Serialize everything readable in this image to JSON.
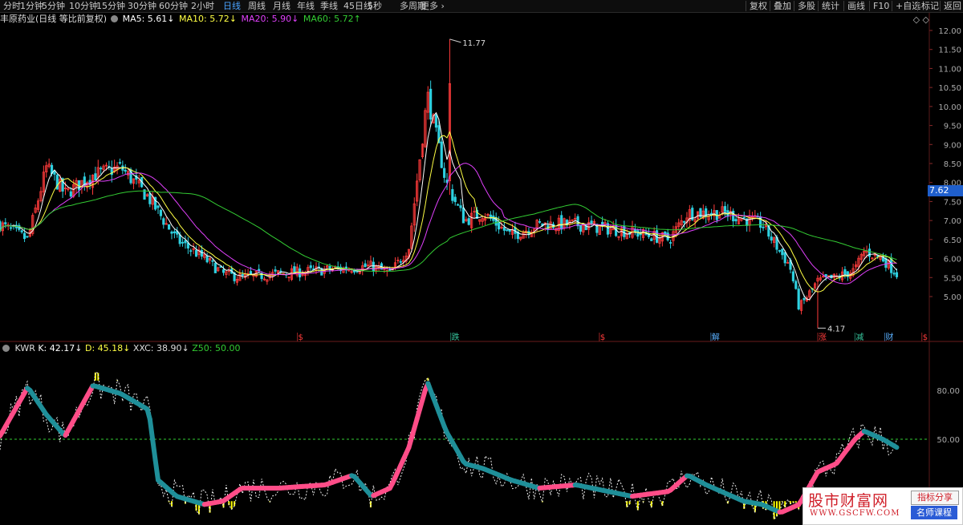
{
  "toolbar": {
    "left_items": [
      "分时",
      "1分钟",
      "5分钟",
      "10分钟",
      "15分钟",
      "30分钟",
      "60分钟",
      "2小时",
      "日线",
      "周线",
      "月线",
      "年线",
      "季线",
      "45日线",
      "5秒",
      "多周期",
      "更多 ›"
    ],
    "active_item": "日线",
    "right_items": [
      "复权",
      "叠加",
      "多股",
      "统计",
      "画线",
      "F10",
      "+自选",
      "标记",
      "返回"
    ]
  },
  "main_header": {
    "stock": "丰原药业(日线 等比前复权)",
    "ma5": "MA5: 5.61↓",
    "ma10": "MA10: 5.72↓",
    "ma20": "MA20: 5.90↓",
    "ma60": "MA60: 5.72↑"
  },
  "sub_header": {
    "name": "KWR",
    "k": "K: 42.17↓",
    "d": "D: 45.18↓",
    "xxc": "XXC: 38.90↓",
    "z50": "Z50: 50.00"
  },
  "price_axis": [
    "12.00",
    "11.50",
    "11.00",
    "10.50",
    "10.00",
    "9.50",
    "9.00",
    "8.50",
    "8.00",
    "7.50",
    "7.00",
    "6.50",
    "6.00",
    "5.50",
    "5.00"
  ],
  "indicator_axis": [
    "80.00",
    "50.00"
  ],
  "current_price": "7.62",
  "high_label": "11.77",
  "low_label": "4.17",
  "event_tags": [
    {
      "text": "$",
      "color": "#ff3b3b"
    },
    {
      "text": "跌",
      "color": "#38c9a0"
    },
    {
      "text": "$",
      "color": "#ff3b3b"
    },
    {
      "text": "解",
      "color": "#5ab0ff"
    },
    {
      "text": "涨",
      "color": "#ff3b3b"
    },
    {
      "text": "减",
      "color": "#38c9a0"
    },
    {
      "text": "财",
      "color": "#5ab0ff"
    },
    {
      "text": "$",
      "color": "#ff3b3b"
    }
  ],
  "top_right_icons": "◇ ◇",
  "watermark": {
    "title": "股市财富网",
    "url": "WWW.GSCFW.COM",
    "btn1": "指标分享",
    "btn2": "名师课程"
  },
  "colors": {
    "up": "#ff3b3b",
    "down": "#2ed0e0",
    "ma5": "#ffffff",
    "ma10": "#ffff44",
    "ma20": "#e040fb",
    "ma60": "#33cc33",
    "k_rise": "#ff4d88",
    "k_fall": "#1f8f99",
    "yellow_fill": "#ffff00"
  },
  "chart_data": {
    "type": "candlestick",
    "price_range": [
      4.0,
      12.2
    ],
    "indicator_range": [
      0,
      100
    ],
    "price_keypoints": [
      [
        0,
        6.9
      ],
      [
        0.03,
        6.5
      ],
      [
        0.05,
        8.4
      ],
      [
        0.07,
        7.7
      ],
      [
        0.1,
        8.2
      ],
      [
        0.13,
        8.4
      ],
      [
        0.16,
        7.6
      ],
      [
        0.19,
        6.5
      ],
      [
        0.22,
        6.0
      ],
      [
        0.24,
        5.6
      ],
      [
        0.26,
        5.5
      ],
      [
        0.3,
        5.6
      ],
      [
        0.35,
        5.7
      ],
      [
        0.4,
        5.8
      ],
      [
        0.42,
        5.6
      ],
      [
        0.44,
        6.3
      ],
      [
        0.46,
        10.3
      ],
      [
        0.48,
        8.0
      ],
      [
        0.5,
        7.0
      ],
      [
        0.52,
        7.2
      ],
      [
        0.55,
        6.6
      ],
      [
        0.58,
        6.9
      ],
      [
        0.62,
        6.9
      ],
      [
        0.68,
        6.7
      ],
      [
        0.72,
        6.5
      ],
      [
        0.74,
        7.2
      ],
      [
        0.78,
        7.2
      ],
      [
        0.82,
        6.9
      ],
      [
        0.85,
        5.8
      ],
      [
        0.86,
        4.7
      ],
      [
        0.88,
        5.4
      ],
      [
        0.9,
        5.5
      ],
      [
        0.92,
        5.7
      ],
      [
        0.93,
        6.2
      ],
      [
        0.95,
        6.0
      ],
      [
        0.965,
        5.6
      ]
    ],
    "k_keypoints": [
      [
        0,
        52
      ],
      [
        0.03,
        82
      ],
      [
        0.05,
        65
      ],
      [
        0.07,
        52
      ],
      [
        0.1,
        83
      ],
      [
        0.13,
        78
      ],
      [
        0.16,
        68
      ],
      [
        0.17,
        25
      ],
      [
        0.19,
        15
      ],
      [
        0.22,
        10
      ],
      [
        0.24,
        12
      ],
      [
        0.26,
        20
      ],
      [
        0.3,
        20
      ],
      [
        0.35,
        22
      ],
      [
        0.38,
        28
      ],
      [
        0.4,
        15
      ],
      [
        0.42,
        20
      ],
      [
        0.44,
        45
      ],
      [
        0.46,
        85
      ],
      [
        0.48,
        55
      ],
      [
        0.5,
        35
      ],
      [
        0.52,
        32
      ],
      [
        0.55,
        25
      ],
      [
        0.58,
        20
      ],
      [
        0.62,
        22
      ],
      [
        0.68,
        15
      ],
      [
        0.72,
        18
      ],
      [
        0.74,
        28
      ],
      [
        0.76,
        22
      ],
      [
        0.8,
        12
      ],
      [
        0.82,
        10
      ],
      [
        0.84,
        5
      ],
      [
        0.86,
        10
      ],
      [
        0.88,
        30
      ],
      [
        0.9,
        35
      ],
      [
        0.92,
        50
      ],
      [
        0.93,
        55
      ],
      [
        0.95,
        50
      ],
      [
        0.965,
        45
      ]
    ]
  }
}
